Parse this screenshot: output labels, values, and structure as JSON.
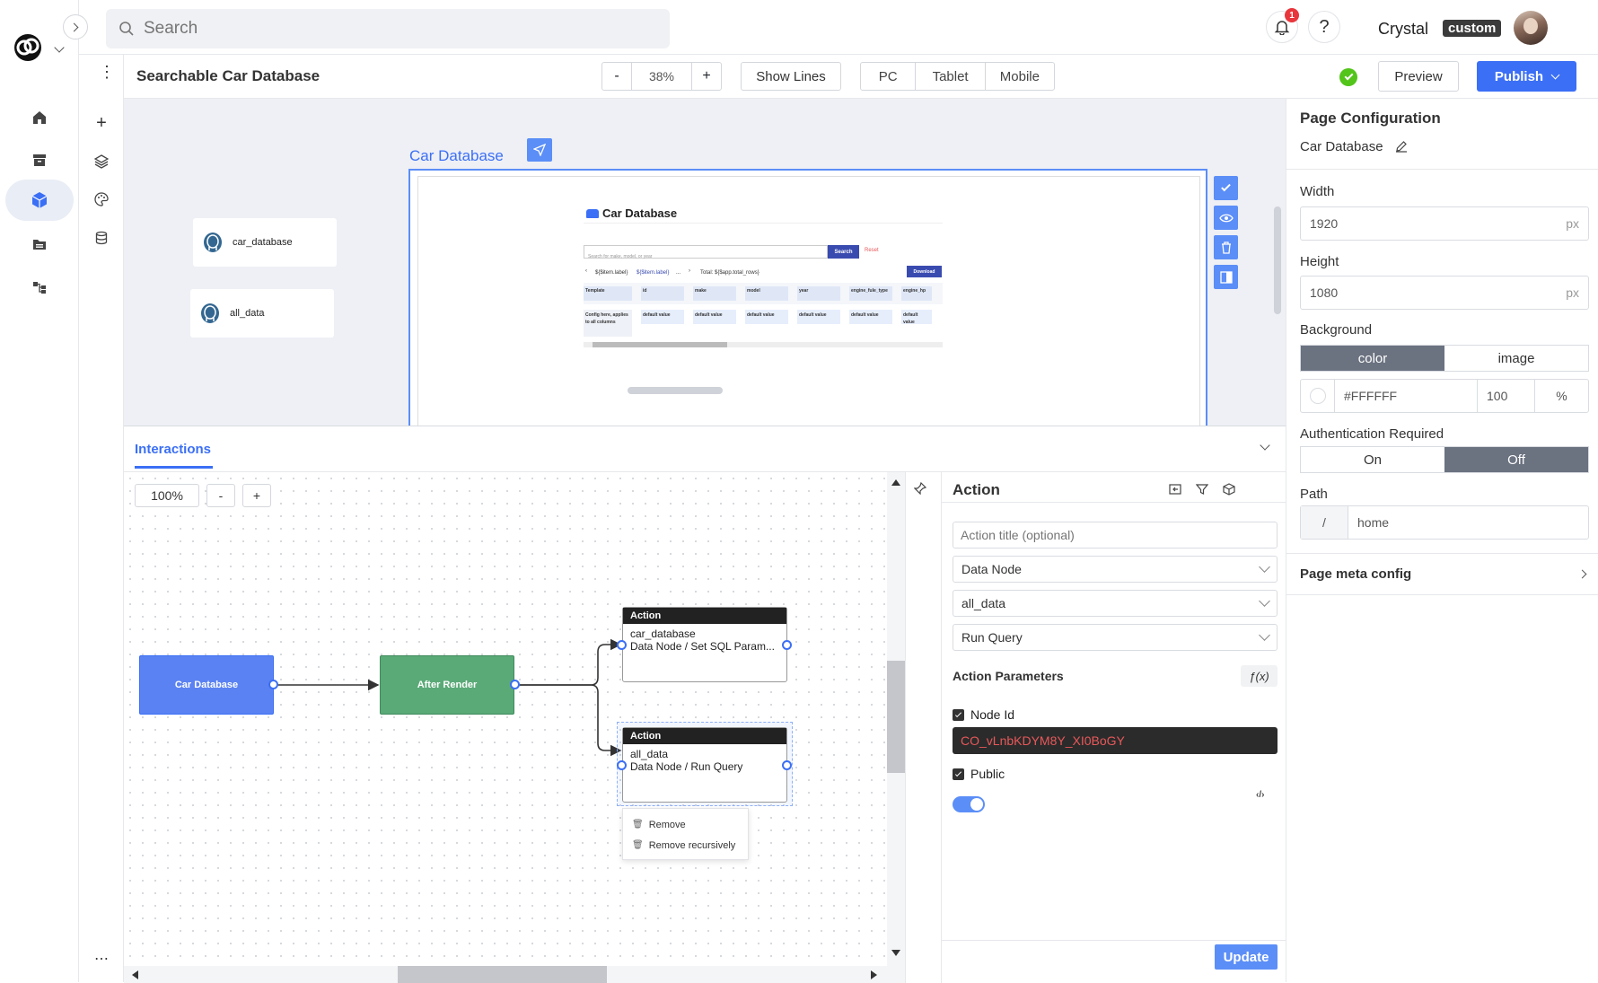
{
  "search": {
    "placeholder": "Search"
  },
  "user": {
    "name": "Crystal",
    "badge": "custom",
    "notifications": "1"
  },
  "toolbar": {
    "page_title": "Searchable Car Database",
    "zoom_minus": "-",
    "zoom_value": "38%",
    "zoom_plus": "+",
    "show_lines": "Show Lines",
    "devices": [
      "PC",
      "Tablet",
      "Mobile"
    ],
    "preview": "Preview",
    "publish": "Publish"
  },
  "canvas": {
    "page_label": "Car Database",
    "data_nodes": [
      "car_database",
      "all_data"
    ],
    "preview": {
      "title": "Car Database",
      "search_placeholder": "Search for make, model, or year",
      "search_btn": "Search",
      "reset": "Reset",
      "pager_label1": "${$item.label}",
      "pager_label2": "${$item.label}",
      "pager_dots": "...",
      "total": "Total: ${$app.total_rows}",
      "download": "Download",
      "columns": [
        "Template",
        "id",
        "make",
        "model",
        "year",
        "engine_fule_type",
        "engine_hp"
      ],
      "row_first": "Config here, applies to all columns",
      "row_default": "default value"
    }
  },
  "interactions": {
    "tab": "Interactions",
    "zoom": "100%",
    "zoom_minus": "-",
    "zoom_plus": "+",
    "flow": {
      "source": "Car Database",
      "event": "After Render",
      "actions": [
        {
          "header": "Action",
          "name": "car_database",
          "desc": "Data Node / Set SQL Param..."
        },
        {
          "header": "Action",
          "name": "all_data",
          "desc": "Data Node / Run Query"
        }
      ],
      "context_menu": [
        "Remove",
        "Remove recursively"
      ]
    }
  },
  "action_panel": {
    "title": "Action",
    "title_placeholder": "Action title (optional)",
    "type": "Data Node",
    "node": "all_data",
    "method": "Run Query",
    "params_label": "Action Parameters",
    "fx": "ƒ(x)",
    "node_id_label": "Node Id",
    "node_id_value": "CO_vLnbKDYM8Y_XI0BoGY",
    "public_label": "Public",
    "update": "Update"
  },
  "page_config": {
    "title": "Page Configuration",
    "page_name": "Car Database",
    "width_label": "Width",
    "width": "1920",
    "unit": "px",
    "height_label": "Height",
    "height": "1080",
    "background_label": "Background",
    "bg_tabs": [
      "color",
      "image"
    ],
    "color_value": "#FFFFFF",
    "opacity": "100",
    "percent": "%",
    "auth_label": "Authentication Required",
    "auth_options": [
      "On",
      "Off"
    ],
    "path_label": "Path",
    "path_prefix": "/",
    "path_value": "home",
    "meta": "Page meta config"
  },
  "colors": {
    "accent": "#3b6ff5",
    "event_node": "#5aaa77",
    "dark_field": "#2b2b2b",
    "danger_text": "#e8585a"
  }
}
